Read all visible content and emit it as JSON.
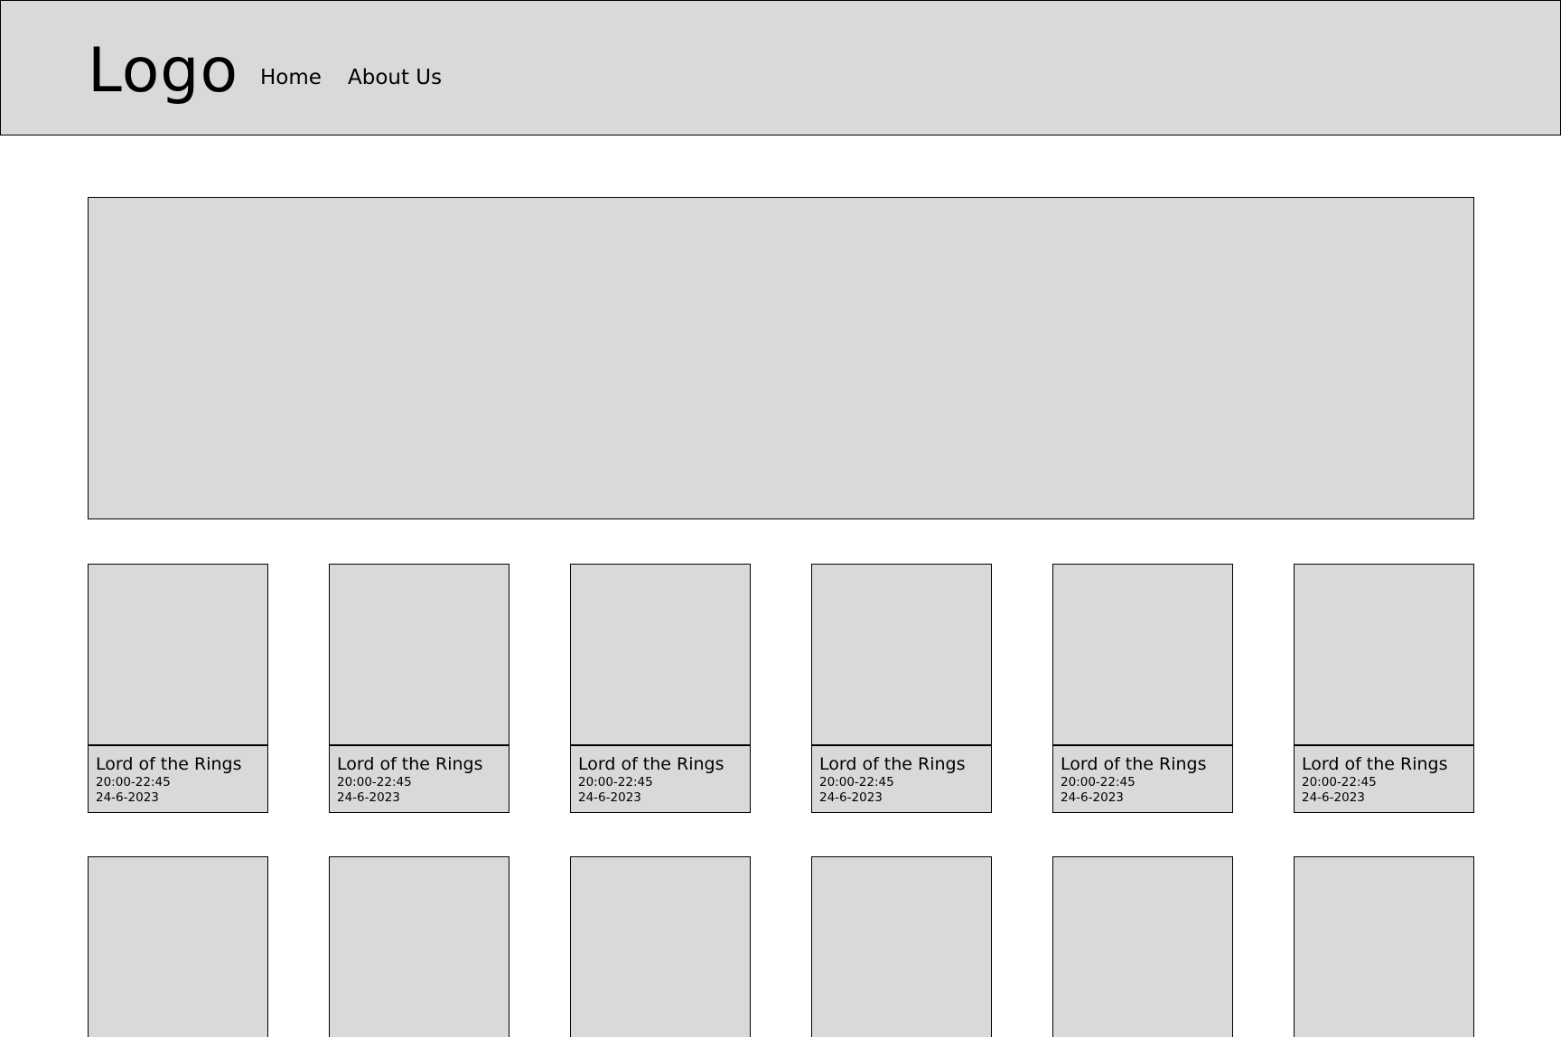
{
  "header": {
    "logo": "Logo",
    "nav": [
      {
        "label": "Home"
      },
      {
        "label": "About Us"
      }
    ]
  },
  "movies": [
    {
      "title": "Lord of the Rings",
      "time": "20:00-22:45",
      "date": "24-6-2023"
    },
    {
      "title": "Lord of the Rings",
      "time": "20:00-22:45",
      "date": "24-6-2023"
    },
    {
      "title": "Lord of the Rings",
      "time": "20:00-22:45",
      "date": "24-6-2023"
    },
    {
      "title": "Lord of the Rings",
      "time": "20:00-22:45",
      "date": "24-6-2023"
    },
    {
      "title": "Lord of the Rings",
      "time": "20:00-22:45",
      "date": "24-6-2023"
    },
    {
      "title": "Lord of the Rings",
      "time": "20:00-22:45",
      "date": "24-6-2023"
    }
  ],
  "colors": {
    "placeholder": "#d9d9d9",
    "border": "#000000",
    "background": "#ffffff"
  }
}
